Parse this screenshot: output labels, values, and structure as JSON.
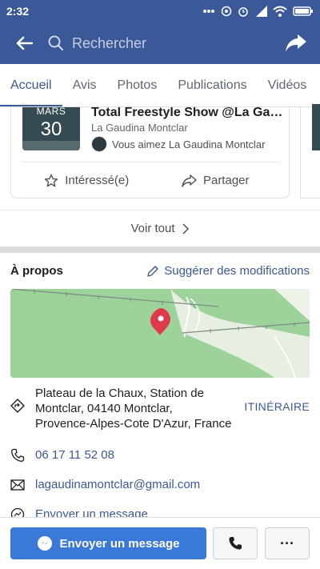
{
  "status_bar": {
    "time": "2:32"
  },
  "app_bar": {
    "search_placeholder": "Rechercher"
  },
  "tabs": [
    {
      "label": "Accueil",
      "active": true
    },
    {
      "label": "Avis"
    },
    {
      "label": "Photos"
    },
    {
      "label": "Publications"
    },
    {
      "label": "Vidéos"
    }
  ],
  "event": {
    "month": "MARS",
    "day": "30",
    "title": "Total Freestyle Show @La Gaudina Montclar",
    "organizer": "La Gaudina Montclar",
    "like_text": "Vous aimez La Gaudina Montclar",
    "interested_label": "Intéressé(e)",
    "share_label": "Partager"
  },
  "see_all": {
    "label": "Voir tout"
  },
  "about": {
    "title": "À propos",
    "suggest_label": "Suggérer des modifications",
    "address_line1": "Plateau de la Chaux, Station de",
    "address_line2": "Montclar, 04140 Montclar,",
    "address_line3": "Provence-Alpes-Cote D'Azur, France",
    "directions_label": "ITINÉRAIRE",
    "phone": "06 17 11 52 08",
    "email": "lagaudinamontclar@gmail.com",
    "message_link": "Envoyer un message"
  },
  "bottom_bar": {
    "message_button": "Envoyer un message",
    "more_label": "···"
  },
  "colors": {
    "brand": "#3b5998",
    "button_blue": "#3b79d8",
    "map_green": "#9dd29a",
    "pin_red": "#e0394b"
  }
}
